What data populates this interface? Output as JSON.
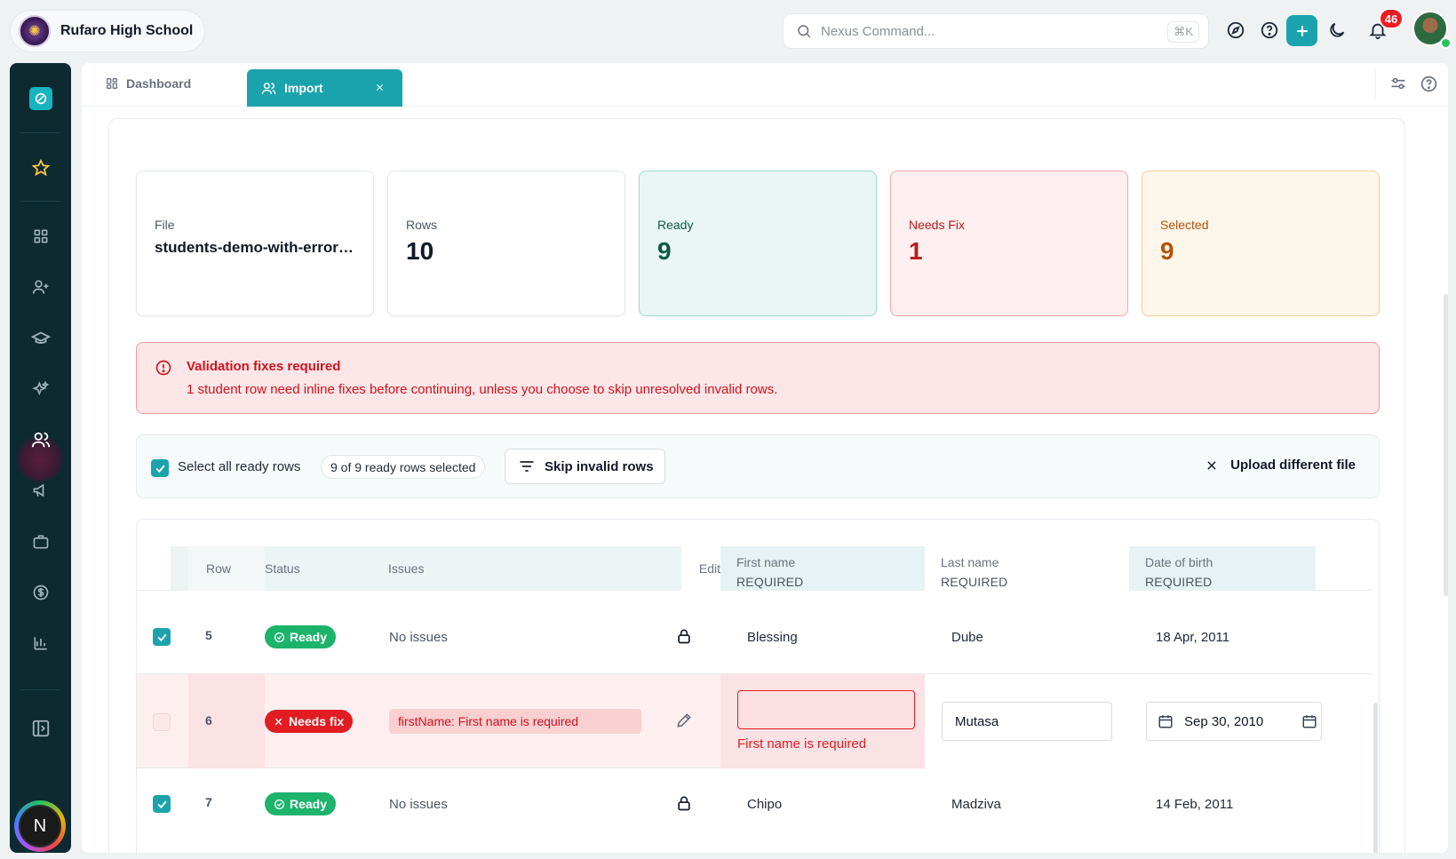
{
  "school": {
    "name": "Rufaro High School"
  },
  "search": {
    "placeholder": "Nexus Command...",
    "shortcut": "⌘K"
  },
  "notifications": {
    "count": "46"
  },
  "tabs": {
    "dashboard_label": "Dashboard",
    "import_label": "Import"
  },
  "stats": {
    "file": {
      "label": "File",
      "value": "students-demo-with-errors.csv"
    },
    "rows": {
      "label": "Rows",
      "value": "10"
    },
    "ready": {
      "label": "Ready",
      "value": "9"
    },
    "needs_fix": {
      "label": "Needs Fix",
      "value": "1"
    },
    "selected": {
      "label": "Selected",
      "value": "9"
    }
  },
  "alert": {
    "title": "Validation fixes required",
    "text": "1 student row need inline fixes before continuing, unless you choose to skip unresolved invalid rows."
  },
  "toolbar": {
    "select_all_label": "Select all ready rows",
    "selected_count": "9 of 9 ready rows selected",
    "skip_label": "Skip invalid rows",
    "upload_label": "Upload different file"
  },
  "table": {
    "headers": {
      "row": "Row",
      "status": "Status",
      "issues": "Issues",
      "edit": "Edit",
      "first_name": "First name",
      "last_name": "Last name",
      "dob": "Date of birth",
      "required": "REQUIRED"
    },
    "rows": [
      {
        "num": "5",
        "status": "Ready",
        "issues": "No issues",
        "first": "Blessing",
        "last": "Dube",
        "dob": "18 Apr, 2011"
      },
      {
        "num": "6",
        "status": "Needs fix",
        "issues": "firstName: First name is required",
        "first": "",
        "first_error": "First name is required",
        "last": "Mutasa",
        "dob": "Sep 30, 2010"
      },
      {
        "num": "7",
        "status": "Ready",
        "issues": "No issues",
        "first": "Chipo",
        "last": "Madziva",
        "dob": "14 Feb, 2011"
      }
    ]
  },
  "sidebar": {
    "user_initial": "N"
  },
  "colors": {
    "accent": "#1ba3ad",
    "error": "#e11d23",
    "ready": "#1cb36b",
    "sidebar": "#0d2a31"
  }
}
